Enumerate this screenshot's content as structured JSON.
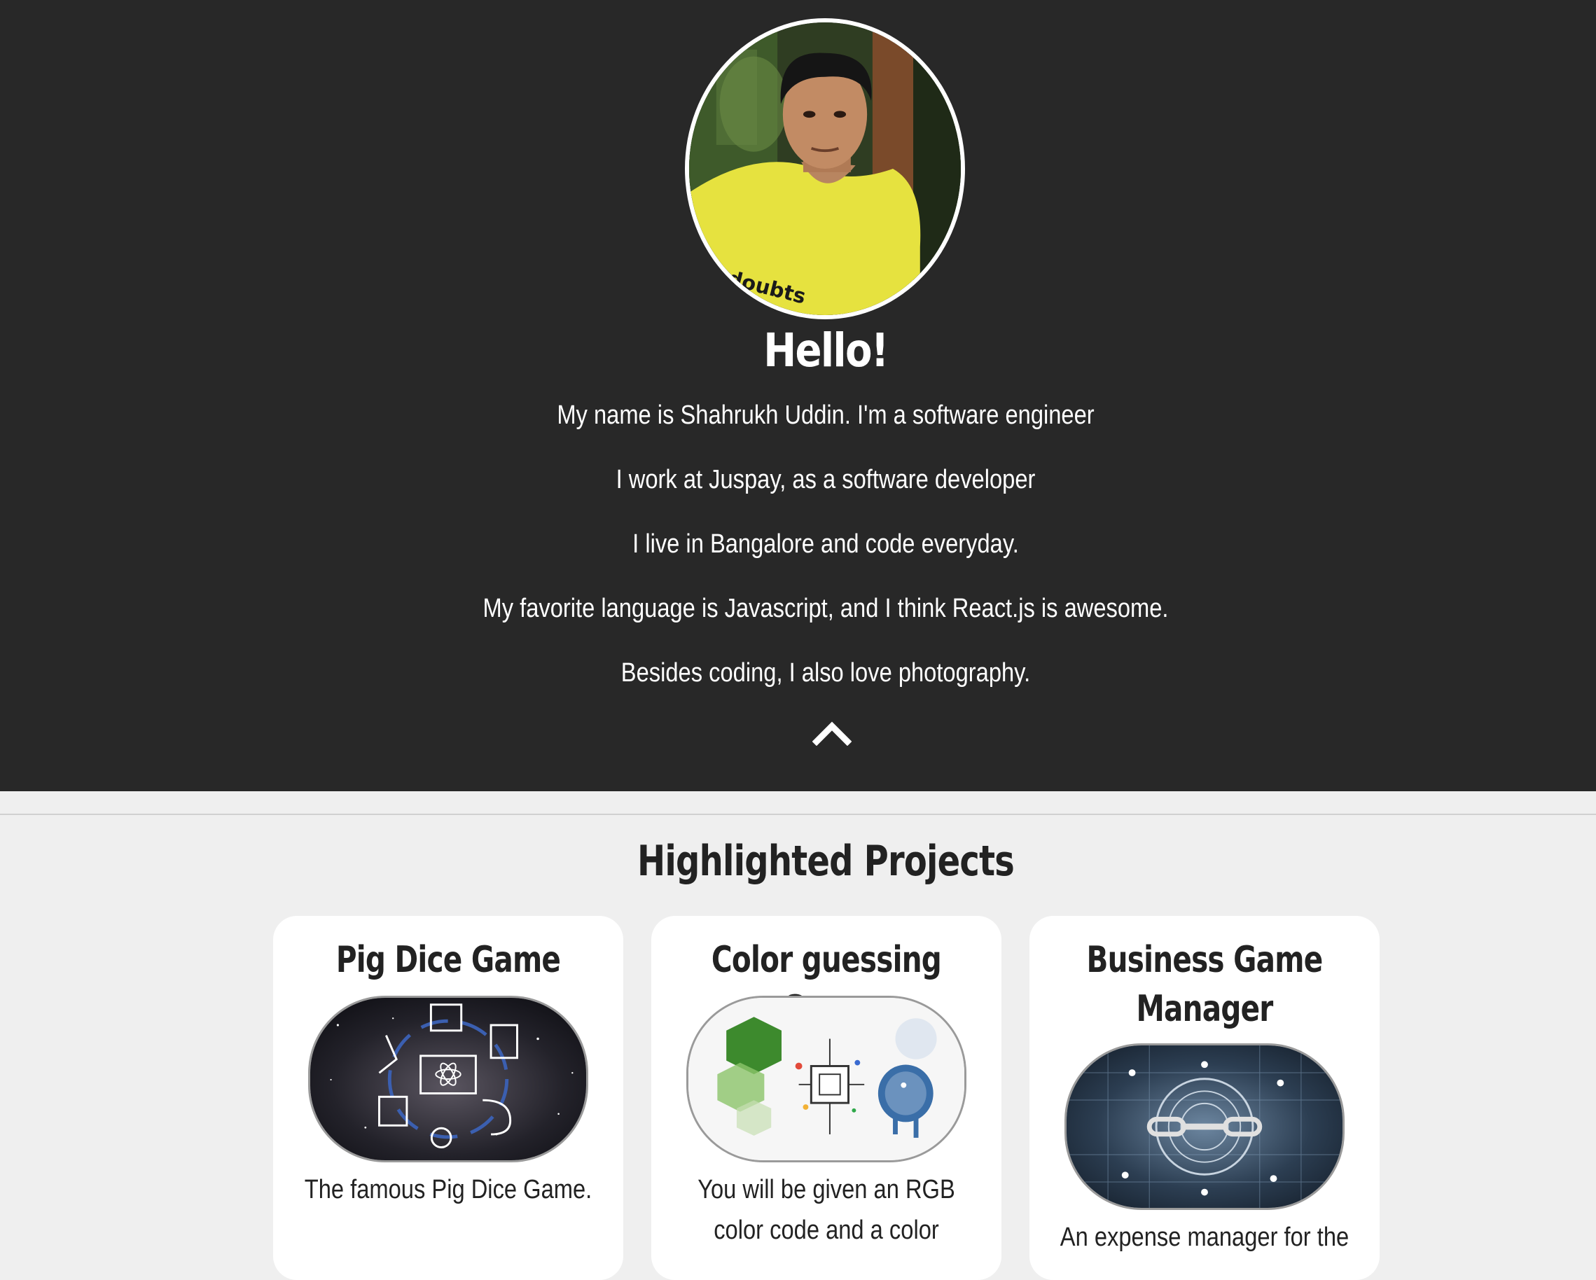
{
  "hero": {
    "greeting": "Hello!",
    "bio": [
      "My name is Shahrukh Uddin. I'm a software engineer",
      "I work at Juspay, as a software developer",
      "I live in Bangalore and code everyday.",
      "My favorite language is Javascript, and I think React.js is awesome.",
      "Besides coding, I also love photography."
    ],
    "tshirt_text": "doubts",
    "collapse_icon": "chevron-up-icon"
  },
  "projects": {
    "title": "Highlighted Projects",
    "items": [
      {
        "title": "Pig Dice Game",
        "description": "The famous Pig Dice Game."
      },
      {
        "title": "Color guessing Game",
        "description_lines": [
          "You will be given an RGB",
          "color code and a color"
        ]
      },
      {
        "title_lines": [
          "Business Game",
          "Manager"
        ],
        "description": "An expense manager for the"
      }
    ]
  },
  "colors": {
    "hero_bg": "#282828",
    "page_bg": "#efefef",
    "card_bg": "#ffffff",
    "text_dark": "#222222",
    "text_light": "#ffffff"
  }
}
